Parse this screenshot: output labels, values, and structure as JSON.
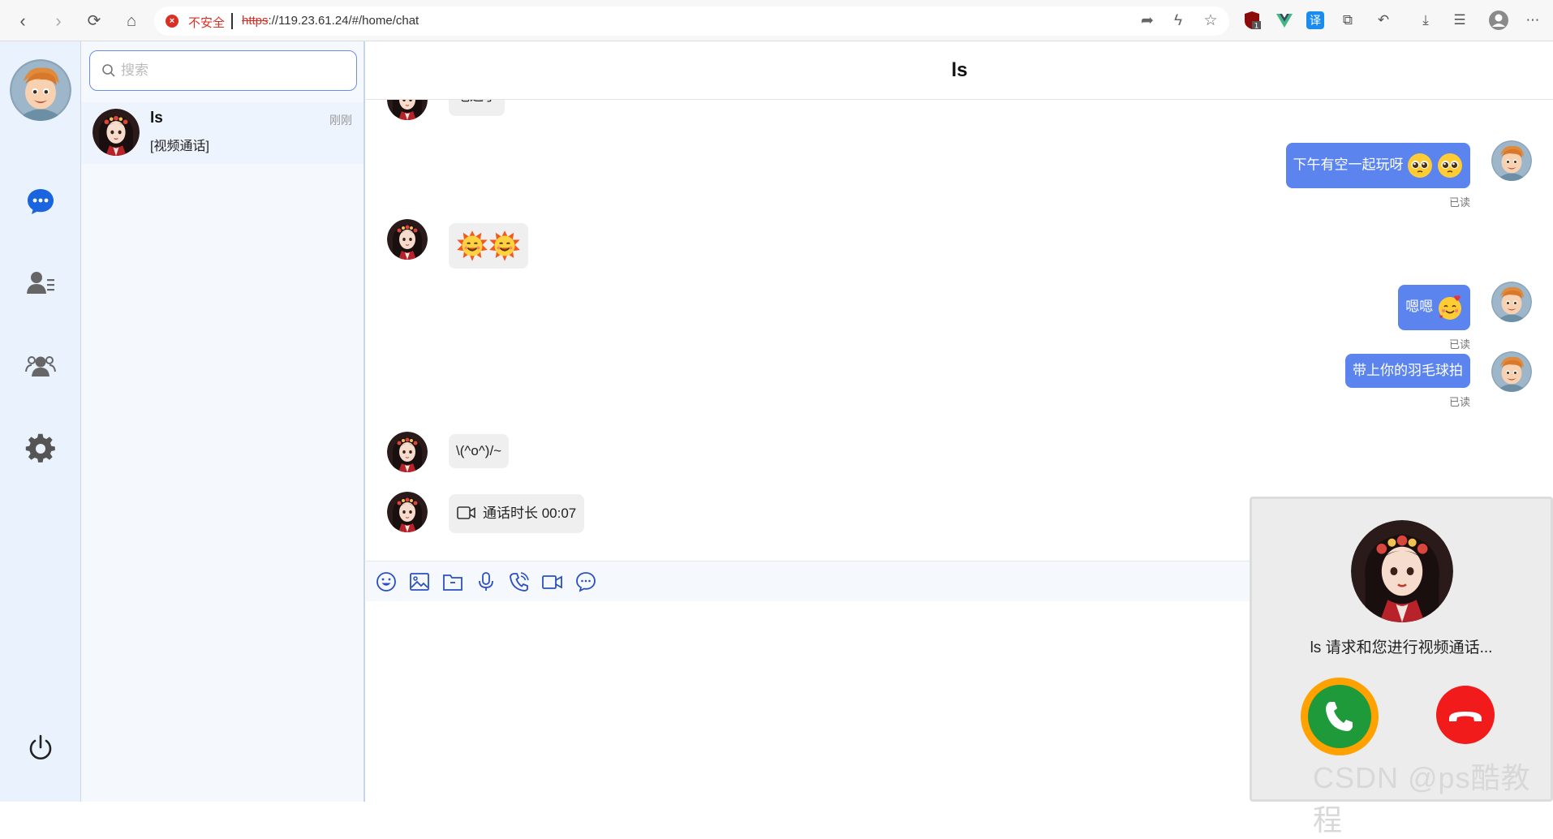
{
  "browser": {
    "security_label": "不安全",
    "url_scheme": "https",
    "url_rest": "://119.23.61.24/#/home/chat",
    "ext_badge": "1",
    "ext_translate": "译"
  },
  "search": {
    "placeholder": "搜索"
  },
  "conversation": {
    "name": "ls",
    "time": "刚刚",
    "preview": "[视频通话]"
  },
  "chat": {
    "title": "ls",
    "messages": [
      {
        "from": "them",
        "text": "吃过了"
      },
      {
        "from": "me",
        "text": "下午有空一起玩呀",
        "status": "已读"
      },
      {
        "from": "them",
        "text": ""
      },
      {
        "from": "me",
        "text": "嗯嗯",
        "status": "已读"
      },
      {
        "from": "me",
        "text": "带上你的羽毛球拍",
        "status": "已读"
      },
      {
        "from": "them",
        "text": "\\(^o^)/~"
      },
      {
        "from": "them",
        "text": "通话时长 00:07"
      }
    ]
  },
  "call": {
    "text": "ls 请求和您进行视频通话..."
  },
  "watermark": "CSDN @ps酷教程",
  "colors": {
    "accent": "#5b84ef",
    "rail": "#eaf2fd",
    "accept": "#1e9a3a",
    "decline": "#f21b1b",
    "ring": "#ffa200"
  }
}
